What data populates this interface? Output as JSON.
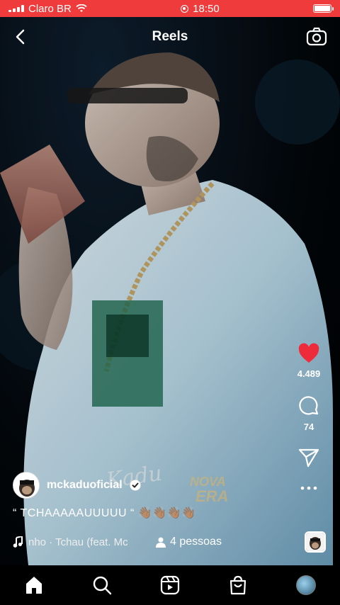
{
  "status_bar": {
    "carrier": "Claro BR",
    "time": "18:50"
  },
  "header": {
    "title": "Reels"
  },
  "actions": {
    "likes": "4.489",
    "comments": "74"
  },
  "post": {
    "username": "mckaduoficial",
    "caption": "“ TCHAAAAAUUUUU “ 👋🏽👋🏽👋🏽👋🏽",
    "music": "nho · Tchau (feat. Mc",
    "people": "4 pessoas"
  },
  "watermark": {
    "left": "Kadu",
    "right_top": "NOVA",
    "right_bottom": "ERA"
  },
  "colors": {
    "status_bar": "#ef3b3b",
    "like": "#ed2b3a"
  }
}
